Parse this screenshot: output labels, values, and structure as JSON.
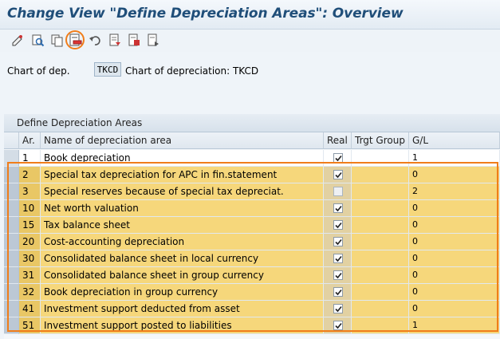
{
  "window": {
    "title": "Change View \"Define Depreciation Areas\": Overview"
  },
  "toolbar": {
    "buttons": [
      {
        "name": "change-display-icon"
      },
      {
        "name": "search-icon"
      },
      {
        "name": "copy-icon"
      },
      {
        "name": "delete-icon"
      },
      {
        "name": "undo-icon"
      },
      {
        "name": "select-all-icon"
      },
      {
        "name": "select-block-icon"
      },
      {
        "name": "deselect-all-icon"
      }
    ]
  },
  "header": {
    "chart_label": "Chart of dep.",
    "chart_value": "TKCD",
    "chart_desc": "Chart of depreciation: TKCD"
  },
  "table": {
    "title": "Define Depreciation Areas",
    "columns": {
      "ar": "Ar.",
      "name": "Name of depreciation area",
      "real": "Real",
      "tg": "Trgt Group",
      "gl": "G/L"
    },
    "rows": [
      {
        "ar": "1",
        "name": "Book depreciation",
        "real": true,
        "tg": "",
        "gl": "1",
        "highlight": false
      },
      {
        "ar": "2",
        "name": "Special tax depreciation for APC in fin.statement",
        "real": true,
        "tg": "",
        "gl": "0",
        "highlight": true
      },
      {
        "ar": "3",
        "name": "Special reserves because of special tax depreciat.",
        "real": false,
        "tg": "",
        "gl": "2",
        "highlight": true
      },
      {
        "ar": "10",
        "name": "Net worth valuation",
        "real": true,
        "tg": "",
        "gl": "0",
        "highlight": true
      },
      {
        "ar": "15",
        "name": "Tax balance sheet",
        "real": true,
        "tg": "",
        "gl": "0",
        "highlight": true
      },
      {
        "ar": "20",
        "name": "Cost-accounting depreciation",
        "real": true,
        "tg": "",
        "gl": "0",
        "highlight": true
      },
      {
        "ar": "30",
        "name": "Consolidated balance sheet in local currency",
        "real": true,
        "tg": "",
        "gl": "0",
        "highlight": true
      },
      {
        "ar": "31",
        "name": "Consolidated balance sheet in group currency",
        "real": true,
        "tg": "",
        "gl": "0",
        "highlight": true
      },
      {
        "ar": "32",
        "name": "Book depreciation in group currency",
        "real": true,
        "tg": "",
        "gl": "0",
        "highlight": true
      },
      {
        "ar": "41",
        "name": "Investment support deducted from asset",
        "real": true,
        "tg": "",
        "gl": "0",
        "highlight": true
      },
      {
        "ar": "51",
        "name": "Investment support posted to liabilities",
        "real": true,
        "tg": "",
        "gl": "1",
        "highlight": true
      }
    ]
  },
  "colors": {
    "accent": "#f07d1a",
    "title": "#1f4e79",
    "row_highlight": "#f6d77b"
  }
}
